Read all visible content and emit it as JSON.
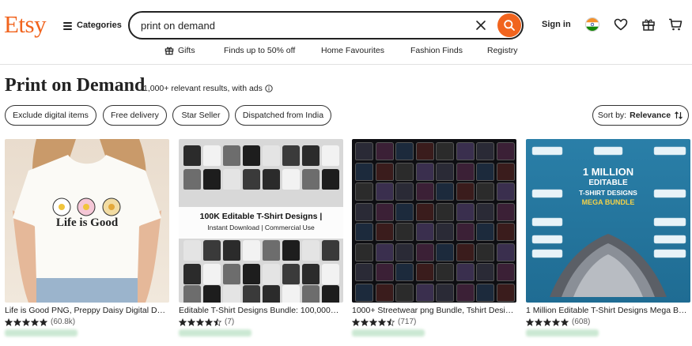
{
  "header": {
    "logo": "Etsy",
    "categories_label": "Categories",
    "search_value": "print on demand",
    "signin_label": "Sign in",
    "colors": {
      "brand": "#f1641e",
      "text": "#222222"
    }
  },
  "subnav": [
    {
      "label": "Gifts",
      "icon": "gift-icon"
    },
    {
      "label": "Finds up to 50% off"
    },
    {
      "label": "Home Favourites"
    },
    {
      "label": "Fashion Finds"
    },
    {
      "label": "Registry"
    }
  ],
  "page": {
    "title": "Print on Demand",
    "result_count": "1,000+ relevant results, with ads"
  },
  "filters": [
    {
      "label": "Exclude digital items"
    },
    {
      "label": "Free delivery"
    },
    {
      "label": "Star Seller"
    },
    {
      "label": "Dispatched from India"
    }
  ],
  "sort": {
    "prefix": "Sort by:",
    "value": "Relevance"
  },
  "products": [
    {
      "title": "Life is Good PNG, Preppy Daisy Digital Design...",
      "stars": 5,
      "rating": "(60.8k)",
      "image_text": "Life is Good"
    },
    {
      "title": "Editable T-Shirt Designs Bundle: 100,000+ Ed...",
      "stars": 4.5,
      "rating": "(7)",
      "image_text": "100K Editable T-Shirt Designs |",
      "image_subtext": "Instant Download | Commercial Use"
    },
    {
      "title": "1000+ Streetwear png Bundle, Tshirt Designs...",
      "stars": 4.5,
      "rating": "(717)"
    },
    {
      "title": "1 Million Editable T-Shirt Designs Mega Bundle...",
      "stars": 5,
      "rating": "(608)",
      "image_text": "1 MILLION",
      "image_text2": "EDITABLE",
      "image_text3": "T-SHIRT DESIGNS",
      "image_text4": "MEGA BUNDLE"
    }
  ]
}
